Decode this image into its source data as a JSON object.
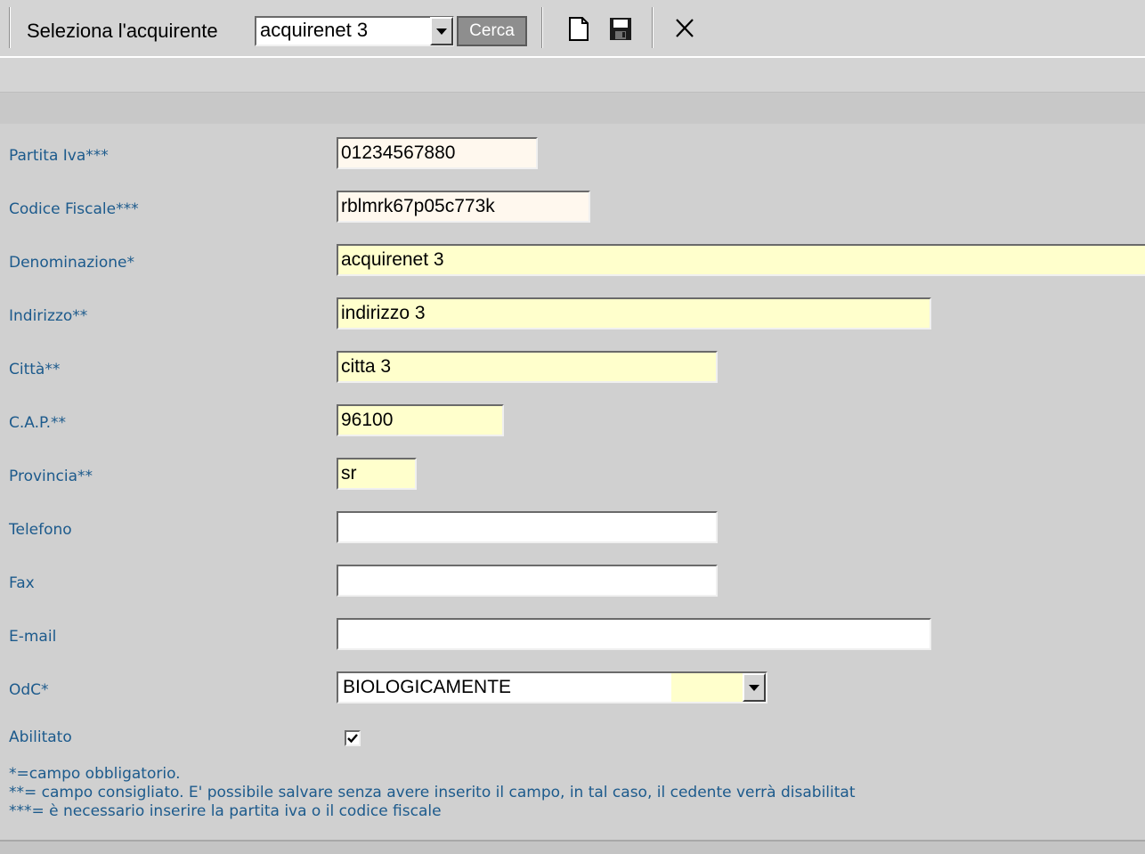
{
  "toolbar": {
    "select_label": "Seleziona l'acquirente",
    "selected_buyer": "acquirenet 3",
    "search_button": "Cerca"
  },
  "form": {
    "partita_iva": {
      "label": "Partita Iva***",
      "value": "01234567880"
    },
    "codice_fiscale": {
      "label": "Codice Fiscale***",
      "value": "rblmrk67p05c773k"
    },
    "denominazione": {
      "label": "Denominazione*",
      "value": "acquirenet 3"
    },
    "indirizzo": {
      "label": "Indirizzo**",
      "value": "indirizzo 3"
    },
    "citta": {
      "label": "Città**",
      "value": "citta 3"
    },
    "cap": {
      "label": "C.A.P.**",
      "value": "96100"
    },
    "provincia": {
      "label": "Provincia**",
      "value": "sr"
    },
    "telefono": {
      "label": "Telefono",
      "value": ""
    },
    "fax": {
      "label": "Fax",
      "value": ""
    },
    "email": {
      "label": "E-mail",
      "value": ""
    },
    "odc": {
      "label": "OdC*",
      "value": "BIOLOGICAMENTE"
    },
    "abilitato": {
      "label": "Abilitato",
      "checked": true
    }
  },
  "notes": {
    "required": "*=campo obbligatorio.",
    "recommended": "**= campo consigliato. E' possibile salvare senza avere inserito il campo, in tal caso, il cedente verrà disabilitat",
    "vat_or_cf": "***= è necessario inserire la partita iva o il codice fiscale"
  },
  "colors": {
    "label_text": "#1c5a8c",
    "required_field_bg": "#ffffcc",
    "id_field_bg": "#fff8ee",
    "background": "#d4d4d4"
  },
  "icons": [
    "new-document-icon",
    "save-icon",
    "close-icon",
    "chevron-down-icon",
    "checkmark-icon"
  ]
}
